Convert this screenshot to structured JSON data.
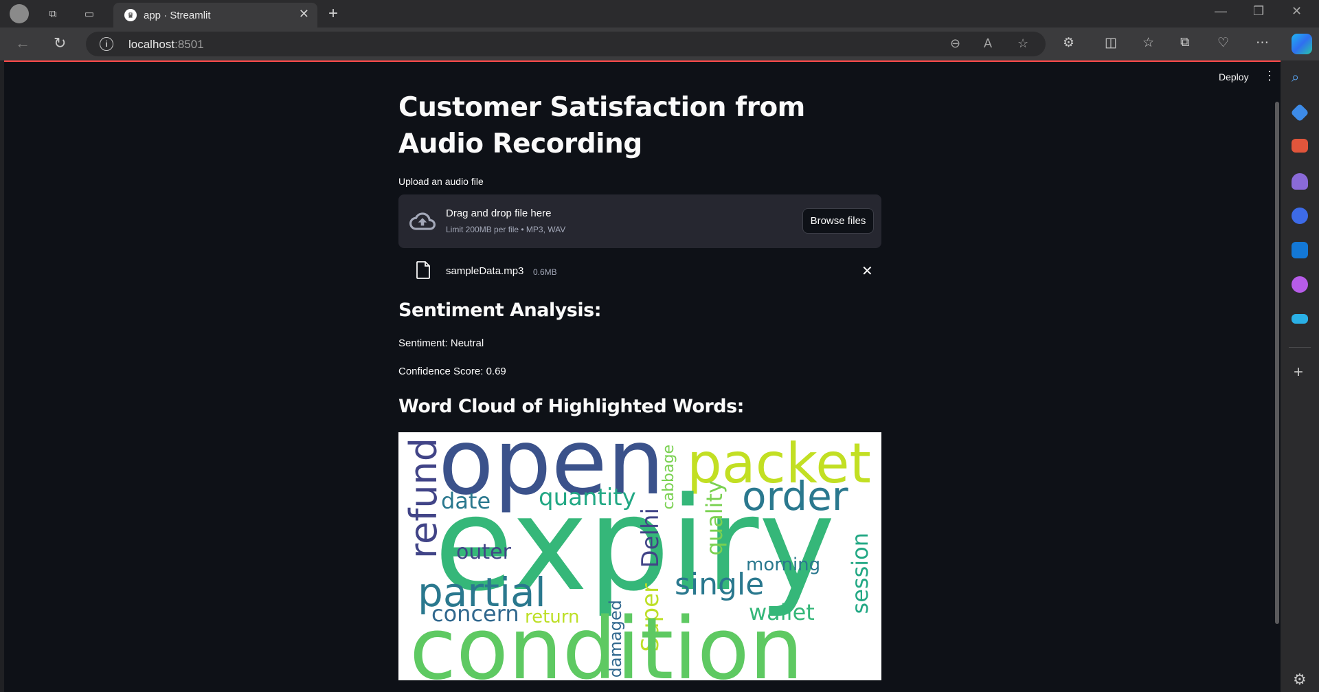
{
  "browser": {
    "tab_title": "app · Streamlit",
    "url_host": "localhost",
    "url_port": ":8501"
  },
  "app": {
    "deploy_label": "Deploy",
    "title": "Customer Satisfaction from Audio Recording",
    "uploader": {
      "label": "Upload an audio file",
      "drop_title": "Drag and drop file here",
      "drop_sub": "Limit 200MB per file • MP3, WAV",
      "browse_label": "Browse files",
      "file_name": "sampleData.mp3",
      "file_size": "0.6MB"
    },
    "sentiment": {
      "heading": "Sentiment Analysis:",
      "sentiment_line": "Sentiment: Neutral",
      "confidence_line": "Confidence Score: 0.69"
    },
    "wordcloud": {
      "heading": "Word Cloud of Highlighted Words:",
      "words": [
        "open",
        "packet",
        "expiry",
        "order",
        "refund",
        "date",
        "quantity",
        "cabbage",
        "quality",
        "Delhi",
        "outer",
        "morning",
        "session",
        "single",
        "partial",
        "concern",
        "return",
        "wallet",
        "damaged",
        "Super",
        "condition"
      ]
    }
  },
  "colors": {
    "app_bg": "#0e1117",
    "accent": "#ff4b4b",
    "panel": "#262730",
    "browser_chrome": "#3b3b3d"
  }
}
